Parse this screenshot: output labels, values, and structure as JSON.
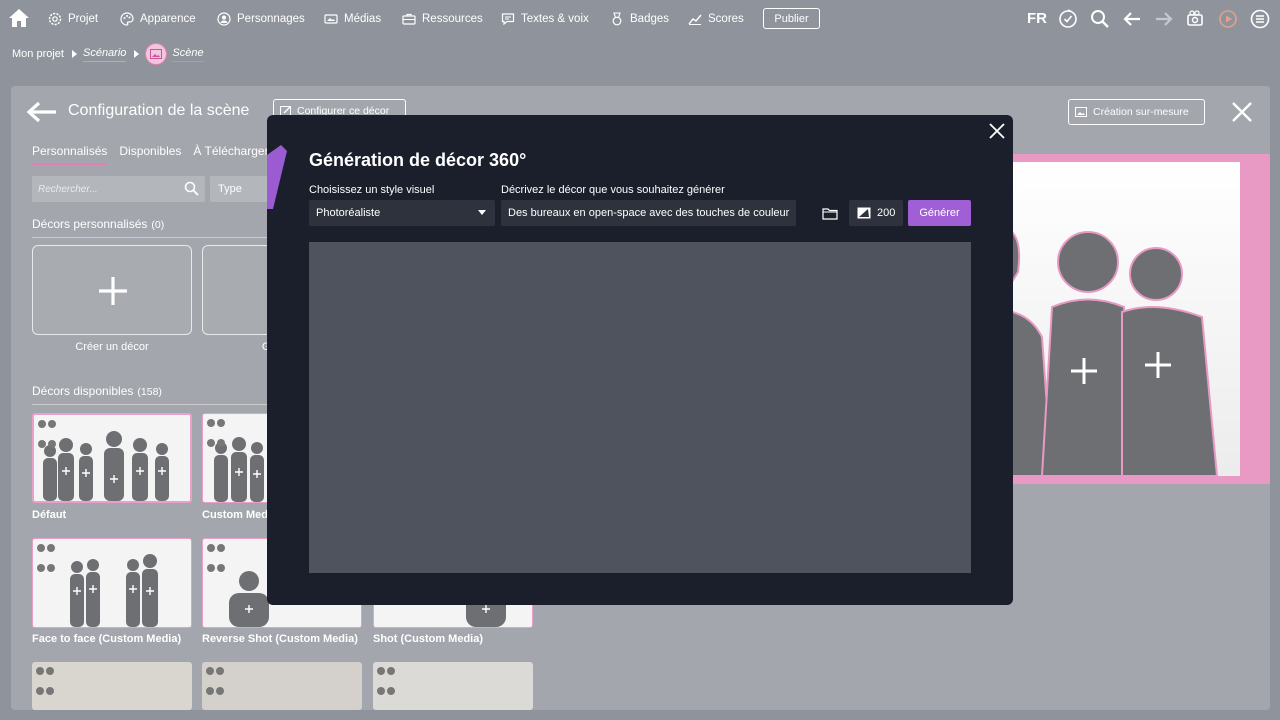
{
  "nav": {
    "items": [
      {
        "label": "Projet",
        "icon": "gear-icon"
      },
      {
        "label": "Apparence",
        "icon": "palette-icon"
      },
      {
        "label": "Personnages",
        "icon": "user-icon"
      },
      {
        "label": "Médias",
        "icon": "media-icon"
      },
      {
        "label": "Ressources",
        "icon": "briefcase-icon"
      },
      {
        "label": "Textes & voix",
        "icon": "speech-icon"
      },
      {
        "label": "Badges",
        "icon": "medal-icon"
      },
      {
        "label": "Scores",
        "icon": "chart-icon"
      }
    ],
    "publish_label": "Publier",
    "language": "FR"
  },
  "breadcrumb": {
    "project": "Mon projet",
    "scenario": "Scénario",
    "scene": "Scène"
  },
  "config": {
    "title": "Configuration de la scène",
    "configure_decor_label": "Configurer ce décor",
    "creation_label": "Création sur-mesure"
  },
  "sidebar": {
    "tabs": [
      "Personnalisés",
      "Disponibles",
      "À Télécharger"
    ],
    "search_placeholder": "Rechercher...",
    "type_label": "Type",
    "custom_section": {
      "label": "Décors personnalisés",
      "count": "(0)"
    },
    "create_tile_label": "Créer un décor",
    "generate_tile_label": "Générer",
    "available_section": {
      "label": "Décors disponibles",
      "count": "(158)"
    },
    "decors": [
      {
        "name": "Défaut"
      },
      {
        "name": "Custom Media"
      },
      {
        "name": "Face to face (Custom Media)"
      },
      {
        "name": "Reverse Shot (Custom Media)"
      },
      {
        "name": "Shot (Custom Media)"
      }
    ]
  },
  "modal": {
    "title": "Génération de décor 360°",
    "style_label": "Choisissez un style visuel",
    "style_value": "Photoréaliste",
    "prompt_label": "Décrivez le décor que vous souhaitez générer",
    "prompt_value": "Des bureaux en open-space avec des touches de couleur",
    "credits": "200",
    "generate_label": "Générer"
  },
  "colors": {
    "accent": "#a15fd6",
    "pink": "#e27fb4",
    "modal_bg": "#1a1f2b"
  }
}
